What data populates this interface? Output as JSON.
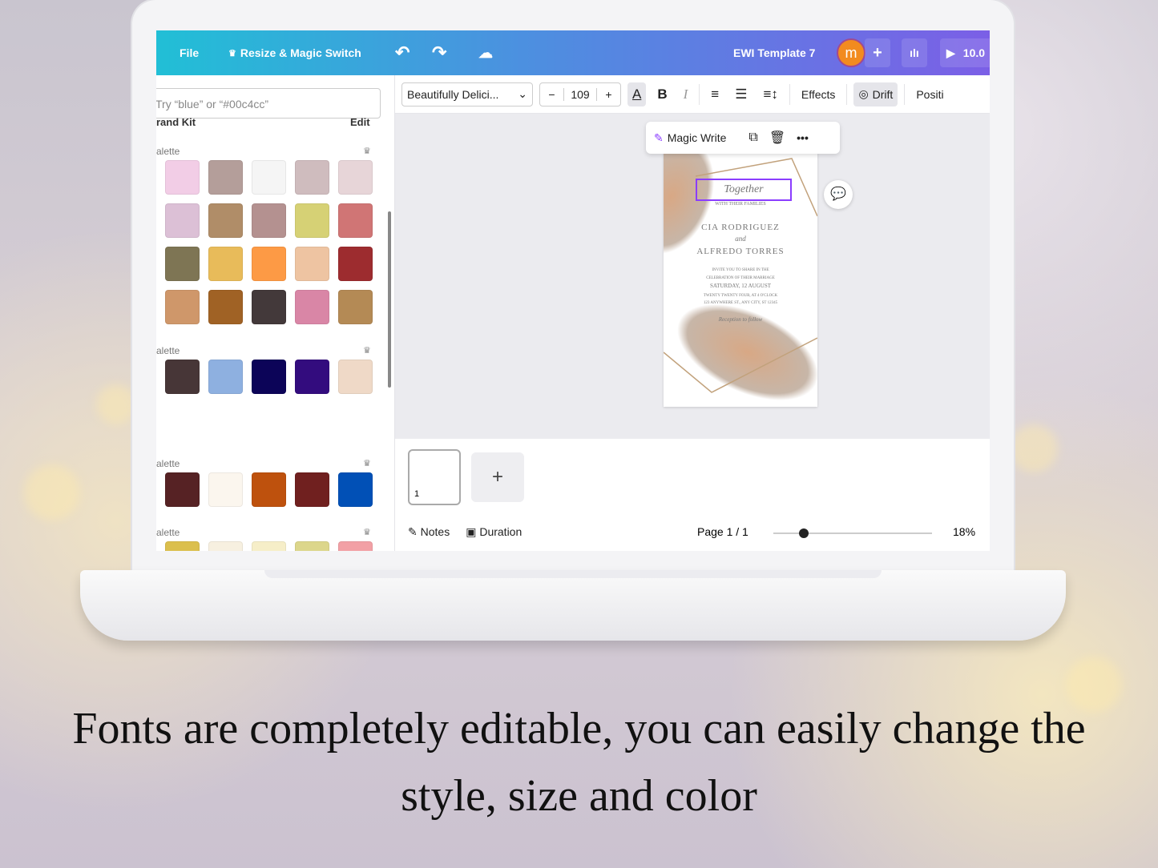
{
  "topbar": {
    "file": "File",
    "resize": "Resize & Magic Switch",
    "title": "EWI Template 7",
    "avatar": "m",
    "share": "10.0"
  },
  "toolbar": {
    "font": "Beautifully Delici...",
    "size": "109",
    "effects": "Effects",
    "drift": "Drift",
    "position": "Positi"
  },
  "sidebar": {
    "search_placeholder": "Try “blue” or “#00c4cc”",
    "brand_kit": "rand Kit",
    "edit": "Edit",
    "palettes": [
      {
        "label": "alette",
        "colors": [
          "#f2cde6",
          "#b49e9a",
          "#f5f5f5",
          "#cfbcbe",
          "#e7d5d8",
          "#dcc0d6",
          "#b08d68",
          "#b49190",
          "#d6d175",
          "#d07575",
          "#7e7554",
          "#e8bb5a",
          "#fd9a45",
          "#eec4a2",
          "#9d2c2f",
          "#cf976a",
          "#a06225",
          "#43393a",
          "#d986a6",
          "#b48a55"
        ]
      },
      {
        "label": "alette",
        "colors": [
          "#473637",
          "#8eb0e0",
          "#0c0458",
          "#330c7e",
          "#efd9c7"
        ]
      },
      {
        "label": "alette",
        "colors": [
          "#562224",
          "#fbf6ee",
          "#be510d",
          "#70201f",
          "#0150b6"
        ]
      },
      {
        "label": "alette",
        "colors": [
          "#dbbf4d",
          "#f7f0e0",
          "#f6eec8",
          "#dcd68b",
          "#f2a0a5"
        ]
      }
    ]
  },
  "float": {
    "magic_write": "Magic Write"
  },
  "card": {
    "together": "Together",
    "families": "WITH THEIR FAMILIES",
    "name1": "CIA RODRIGUEZ",
    "and": "and",
    "name2": "ALFREDO TORRES",
    "invite1": "INVITE YOU TO SHARE IN THE",
    "invite2": "CELEBRATION OF THEIR MARRIAGE",
    "date": "SATURDAY, 12 AUGUST",
    "time": "TWENTY TWENTY FOUR, AT 4 O'CLOCK",
    "addr": "123 ANYWHERE ST., ANY CITY, ST 12345",
    "rsvp": "Reception to follow"
  },
  "bottom": {
    "page_num": "1",
    "notes": "Notes",
    "duration": "Duration",
    "page": "Page 1 / 1",
    "zoom": "18%",
    "zoom_value": 18
  },
  "caption": {
    "line1": "Fonts are completely editable, you can easily change the",
    "line2": "style, size and color"
  }
}
